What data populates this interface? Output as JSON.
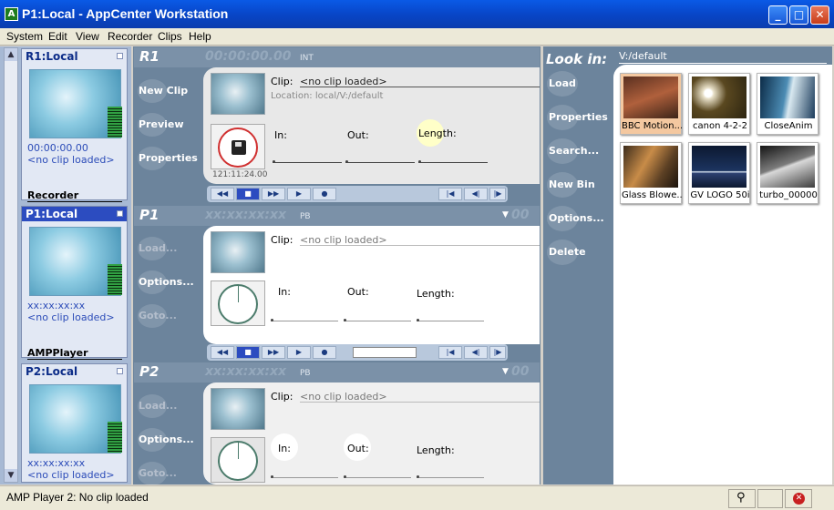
{
  "window": {
    "title": "P1:Local - AppCenter Workstation",
    "app_icon_letter": "A"
  },
  "menu": [
    "System",
    "Edit",
    "View",
    "Recorder",
    "Clips",
    "Help"
  ],
  "monitors": [
    {
      "name": "R1:Local",
      "timecode": "00:00:00.00",
      "clip": "<no clip loaded>",
      "group": "Recorder",
      "selected": false
    },
    {
      "name": "P1:Local",
      "timecode": "xx:xx:xx:xx",
      "clip": "<no clip loaded>",
      "group": "AMPPlayer",
      "selected": true
    },
    {
      "name": "P2:Local",
      "timecode": "xx:xx:xx:xx",
      "clip": "<no clip loaded>",
      "group": "",
      "selected": false
    }
  ],
  "channels": [
    {
      "name": "R1",
      "timecode": "00:00:00.00",
      "mode": "INT",
      "menu": [
        "New Clip",
        "Preview",
        "Properties"
      ],
      "clip_label": "Clip:",
      "clip_value": "<no clip loaded>",
      "location": "Location:  local/V:/default",
      "duration": "121:11:24.00",
      "in_label": "In:",
      "out_label": "Out:",
      "length_label": "Length:"
    },
    {
      "name": "P1",
      "timecode": "xx:xx:xx:xx",
      "mode": "PB",
      "menu": [
        "Load...",
        "Options...",
        "Goto..."
      ],
      "clip_label": "Clip:",
      "clip_value": "<no clip loaded>",
      "in_label": "In:",
      "out_label": "Out:",
      "length_label": "Length:"
    },
    {
      "name": "P2",
      "timecode": "xx:xx:xx:xx",
      "mode": "PB",
      "menu": [
        "Load...",
        "Options...",
        "Goto..."
      ],
      "clip_label": "Clip:",
      "clip_value": "<no clip loaded>",
      "in_label": "In:",
      "out_label": "Out:",
      "length_label": "Length:"
    }
  ],
  "browser": {
    "look_in_label": "Look in:",
    "path": "V:/default",
    "menu": [
      "Load",
      "Properties",
      "Search...",
      "New Bin",
      "Options...",
      "Delete"
    ],
    "clips": [
      {
        "name": "BBC Motion...",
        "selected": true
      },
      {
        "name": "canon 4-2-2",
        "selected": false
      },
      {
        "name": "CloseAnim",
        "selected": false
      },
      {
        "name": "Glass Blowe...",
        "selected": false
      },
      {
        "name": "GV LOGO 50i",
        "selected": false
      },
      {
        "name": "turbo_00000",
        "selected": false
      }
    ]
  },
  "transport_icons": [
    "rewind-icon",
    "stop-icon",
    "fast-forward-icon",
    "play-icon",
    "record-icon"
  ],
  "status": {
    "text": "AMP Player 2: No clip loaded"
  },
  "colors": {
    "accent": "#2c4cc0",
    "panel": "#6c849c",
    "monitor_text": "#2c4cb8"
  }
}
